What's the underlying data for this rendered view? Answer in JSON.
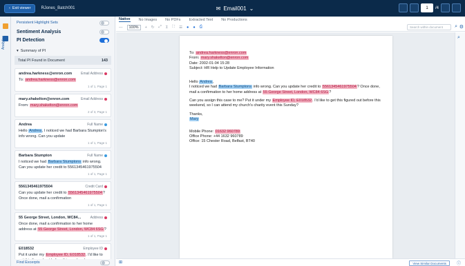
{
  "topbar": {
    "exit_label": "Exit viewer",
    "doc_id": "RJones_Batch001",
    "title": "Email001",
    "page_number": "1",
    "page_total": "/4"
  },
  "rail": {
    "label": "Analytics"
  },
  "panel": {
    "persistent_label": "Persistent Highlight Sets",
    "sentiment_label": "Sentiment Analysis",
    "pi_label": "PI Detection",
    "summary_label": "Summary of PI",
    "total_label": "Total PI Found in Document",
    "total_value": "143",
    "footer_label": "Find Excerpts",
    "cards": [
      {
        "head": "andrea.harkness@enron.com",
        "type": "Email Address",
        "pre": "To: ",
        "hl": "andrea.harkness@enron.com",
        "post": "",
        "foot": "1 of 1, Page 1"
      },
      {
        "head": "mary.shakelton@enron.com",
        "type": "Email Address",
        "pre": "From: ",
        "hl": "mary.shakelton@enron.com",
        "post": "",
        "foot": "2 of 3, Page 1"
      },
      {
        "head": "Andrea",
        "type": "Full Name",
        "pre": "Hello ",
        "hl": "Andrea",
        "post": ", I noticed we had Barbara Stumpton's info wrong. Can you update",
        "foot": "1 of 1, Page 1"
      },
      {
        "head": "Barbara Stumpton",
        "type": "Full Name",
        "pre": "I noticed we had ",
        "hl": "Barbara Stumptons",
        "post": " info wrong. Can you update her credit to 5561345461975504",
        "foot": "1 of 1, Page 1"
      },
      {
        "head": "5561345461975504",
        "type": "Credit Card",
        "pre": "Can you update her credit to ",
        "hl": "5561345461975504",
        "post": "? Once done, mail a confirmation",
        "foot": "1 of 1, Page 1"
      },
      {
        "head": "55 George Street, London, WC84...",
        "type": "Address",
        "pre": "Once done, mail a confirmation to her home address at ",
        "hl": "55 George Street, London, WC84 6SG",
        "post": "?",
        "foot": "1 of 1, Page 1"
      },
      {
        "head": "E018532",
        "type": "Employee ID",
        "pre": "Put it under my ",
        "hl": "Employee ID, E018532",
        "post": ". I'd like to get this figured out before this weekend",
        "foot": "1 of 1, Page 1"
      }
    ]
  },
  "viewer": {
    "tabs": [
      "Native",
      "No Images",
      "No PDFs",
      "Extracted Text",
      "No Productions"
    ],
    "zoom": "100%",
    "search_placeholder": "Search within document"
  },
  "email": {
    "to_label": "To: ",
    "to": "andrea.harkness@enron.com",
    "from_label": "From: ",
    "from": "mary.shakelton@enron.com",
    "date": "Date: 2002-01-04 15:28",
    "subject": "Subject: HR Help to Update Employee Information",
    "hello": "Hello ",
    "hello_name": "Andrea",
    "hello_end": ",",
    "p1a": "I noticed we had ",
    "p1_name": "Barbara Stumptons",
    "p1b": " info wrong. Can you update her credit to ",
    "p1_cc": "5561345461975504",
    "p1c": "? Once done, mail a confirmation to her home address at ",
    "p1_addr": "55 George Street, London, WC84 6SG",
    "p1d": "?",
    "p2a": "Can you assign this case to me? Put it under my ",
    "p2_id": "Employee ID, E018532",
    "p2b": ". I'd like to get this figured out before this weekend, so I can attend my church's charity event this Sunday?",
    "thanks": "Thanks,",
    "sign": "Mary",
    "mobile_label": "Mobile Phone: ",
    "mobile": "01632 960789",
    "office_phone": "Office Phone: +44 1632 960789",
    "office": "Office: 15 Chester Road, Belfast, BT40"
  },
  "bottom": {
    "similar": "View Similar Documents"
  },
  "colors": {
    "topbar": "#0b2a4a",
    "red_hl": "#f3b3c2",
    "blue_hl": "#a7d3f5",
    "accent": "#1e6fd9"
  }
}
